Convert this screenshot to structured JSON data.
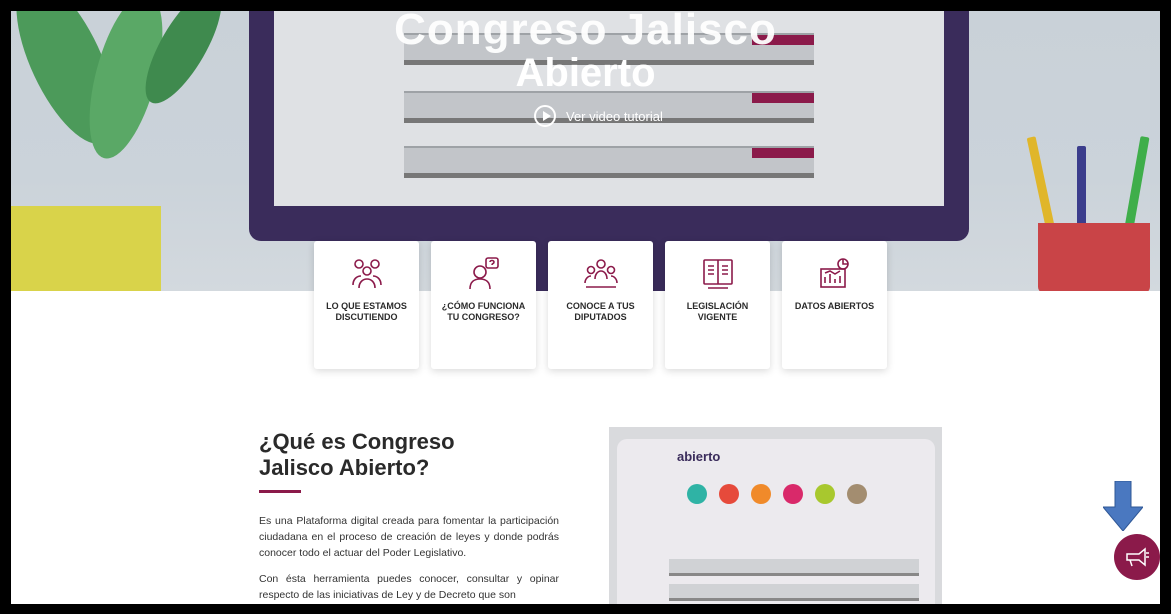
{
  "hero": {
    "title_line1": "Congreso Jalisco",
    "title_line2": "Abierto",
    "video_label": "Ver video tutorial"
  },
  "cards": [
    {
      "label": "LO QUE ESTAMOS DISCUTIENDO",
      "icon": "people-discussion-icon"
    },
    {
      "label": "¿CÓMO FUNCIONA TU CONGRESO?",
      "icon": "person-question-icon"
    },
    {
      "label": "CONOCE A TUS DIPUTADOS",
      "icon": "deputies-group-icon"
    },
    {
      "label": "LEGISLACIÓN VIGENTE",
      "icon": "law-book-icon"
    },
    {
      "label": "DATOS ABIERTOS",
      "icon": "open-data-chart-icon"
    }
  ],
  "about": {
    "title": "¿Qué es Congreso Jalisco Abierto?",
    "paragraph1": "Es una Plataforma digital creada para fomentar la participación ciudadana en el proceso de creación de leyes y donde podrás conocer todo el actuar del Poder Legislativo.",
    "paragraph2": "Con ésta herramienta puedes conocer, consultar y opinar respecto de las iniciativas de Ley y de Decreto que son"
  },
  "preview": {
    "logo": "abierto"
  },
  "colors": {
    "brand": "#8b1a4a",
    "monitor": "#3a2c5b",
    "annotation_arrow": "#4a78c0"
  }
}
